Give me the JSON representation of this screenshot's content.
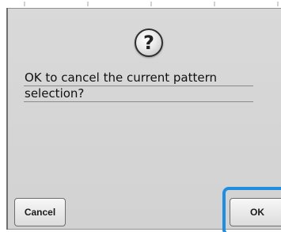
{
  "dialog": {
    "icon": "question-mark-icon",
    "icon_glyph": "?",
    "message_lines": [
      "OK to cancel the current pattern",
      "selection?"
    ]
  },
  "buttons": {
    "cancel_label": "Cancel",
    "ok_label": "OK"
  },
  "colors": {
    "dialog_bg": "#d6d6d6",
    "highlight": "#1f8ee0"
  }
}
